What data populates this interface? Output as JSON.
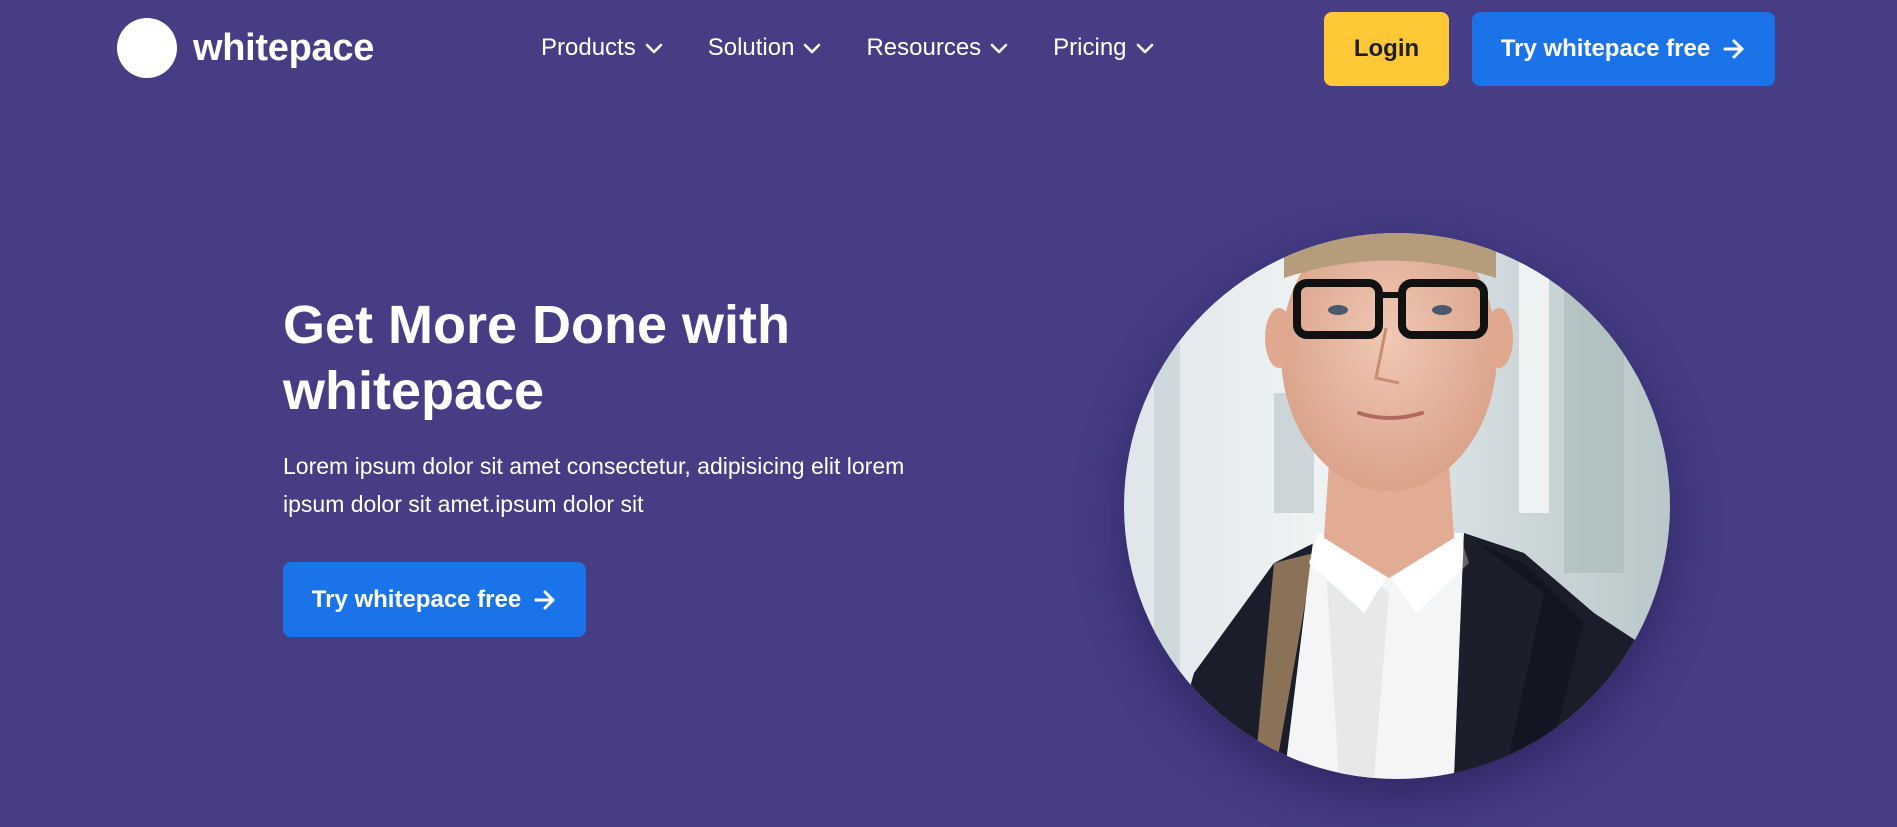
{
  "brand": {
    "name": "whitepace"
  },
  "nav": {
    "items": [
      {
        "label": "Products"
      },
      {
        "label": "Solution"
      },
      {
        "label": "Resources"
      },
      {
        "label": "Pricing"
      }
    ]
  },
  "header": {
    "login_label": "Login",
    "cta_label": "Try whitepace free"
  },
  "hero": {
    "title_line1": "Get More Done with",
    "title_line2": "whitepace",
    "description_line1": "Lorem ipsum dolor sit amet consectetur, adipisicing elit lorem",
    "description_line2": "ipsum dolor sit amet.ipsum dolor sit",
    "cta_label": "Try whitepace free"
  },
  "icons": {
    "dropdown": "chevron-down-icon",
    "cta_arrow": "arrow-right-icon"
  },
  "colors": {
    "background": "#463d85",
    "login_button": "#fec837",
    "cta_button": "#1a73e8",
    "text": "#ffffff"
  }
}
